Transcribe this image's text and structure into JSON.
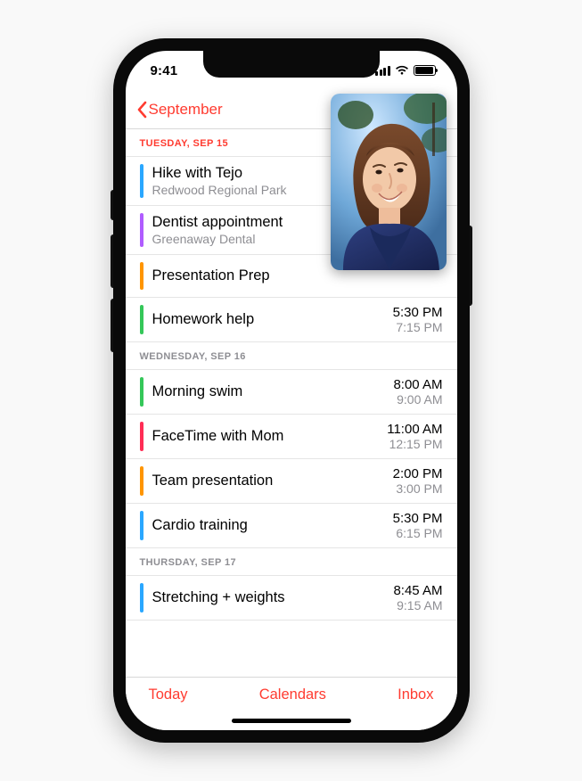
{
  "status": {
    "time": "9:41"
  },
  "nav": {
    "back_label": "September"
  },
  "sections": [
    {
      "header": "TUESDAY, SEP 15",
      "active": true,
      "events": [
        {
          "title": "Hike with Tejo",
          "location": "Redwood Regional Park",
          "start": "",
          "end": "",
          "color": "#2aa7ff"
        },
        {
          "title": "Dentist appointment",
          "location": "Greenaway Dental",
          "start": "",
          "end": "",
          "color": "#b05cff"
        },
        {
          "title": "Presentation Prep",
          "location": "",
          "start": "",
          "end": "",
          "color": "#ff9500"
        },
        {
          "title": "Homework help",
          "location": "",
          "start": "5:30 PM",
          "end": "7:15 PM",
          "color": "#34c759"
        }
      ]
    },
    {
      "header": "WEDNESDAY, SEP 16",
      "active": false,
      "events": [
        {
          "title": "Morning swim",
          "location": "",
          "start": "8:00 AM",
          "end": "9:00 AM",
          "color": "#34c759"
        },
        {
          "title": "FaceTime with Mom",
          "location": "",
          "start": "11:00 AM",
          "end": "12:15 PM",
          "color": "#ff2d55"
        },
        {
          "title": "Team presentation",
          "location": "",
          "start": "2:00 PM",
          "end": "3:00 PM",
          "color": "#ff9500"
        },
        {
          "title": "Cardio training",
          "location": "",
          "start": "5:30 PM",
          "end": "6:15 PM",
          "color": "#2aa7ff"
        }
      ]
    },
    {
      "header": "THURSDAY, SEP 17",
      "active": false,
      "events": [
        {
          "title": "Stretching + weights",
          "location": "",
          "start": "8:45 AM",
          "end": "9:15 AM",
          "color": "#2aa7ff"
        }
      ]
    }
  ],
  "toolbar": {
    "today": "Today",
    "calendars": "Calendars",
    "inbox": "Inbox"
  },
  "pip": {
    "description": "FaceTime picture-in-picture video of a smiling person outdoors"
  }
}
